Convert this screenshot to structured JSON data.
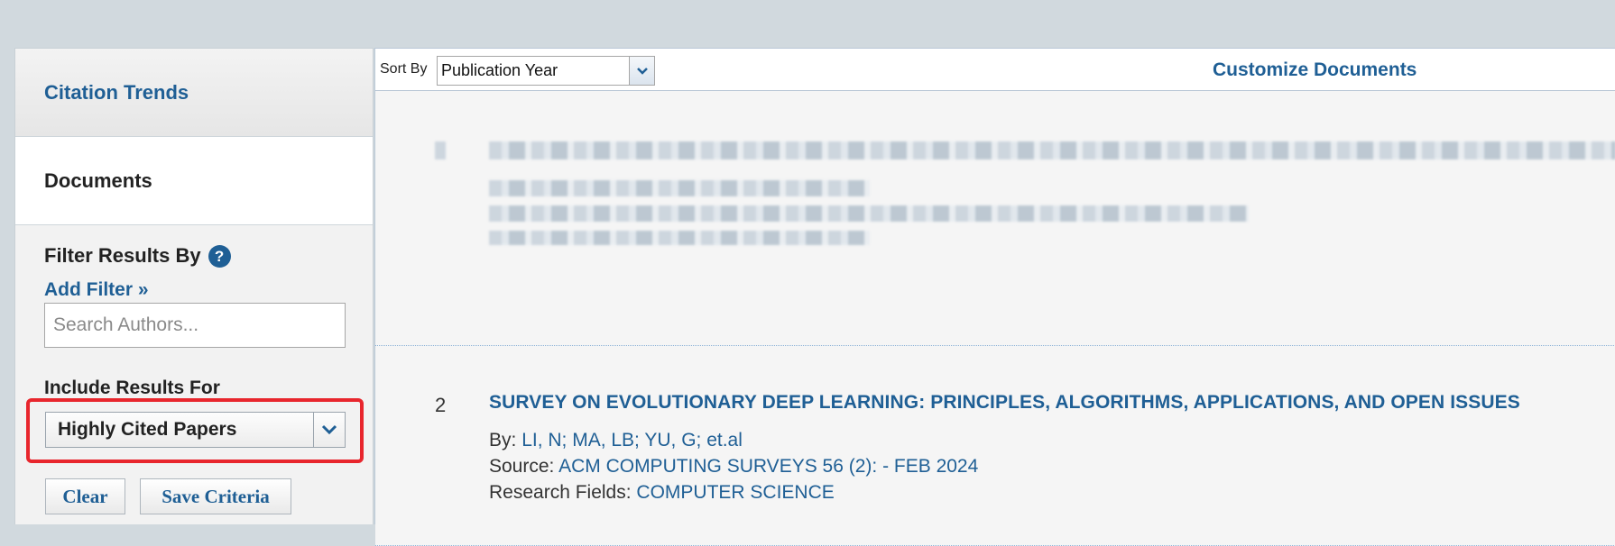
{
  "sidebar": {
    "tabs": [
      {
        "label": "Citation Trends"
      },
      {
        "label": "Documents"
      }
    ],
    "filter_title": "Filter Results By",
    "help_icon": "?",
    "add_filter": "Add Filter »",
    "search_placeholder": "Search Authors...",
    "include_title": "Include Results For",
    "include_selected": "Highly Cited Papers",
    "clear_label": "Clear",
    "save_label": "Save Criteria"
  },
  "toolbar": {
    "sort_label": "Sort By",
    "sort_selected": "Publication Year",
    "customize_label": "Customize Documents"
  },
  "documents": [
    {
      "number": "2",
      "title": "SURVEY ON EVOLUTIONARY DEEP LEARNING: PRINCIPLES, ALGORITHMS, APPLICATIONS, AND OPEN ISSUES",
      "by_label": "By:",
      "authors": "LI, N;  MA, LB;  YU, G;  et.al",
      "source_label": "Source:",
      "source": "ACM COMPUTING SURVEYS 56 (2): - FEB 2024",
      "fields_label": "Research Fields:",
      "fields": "COMPUTER SCIENCE"
    }
  ],
  "colors": {
    "accent": "#1f5f95",
    "highlight": "#e8262d",
    "background": "#d1d9de"
  }
}
